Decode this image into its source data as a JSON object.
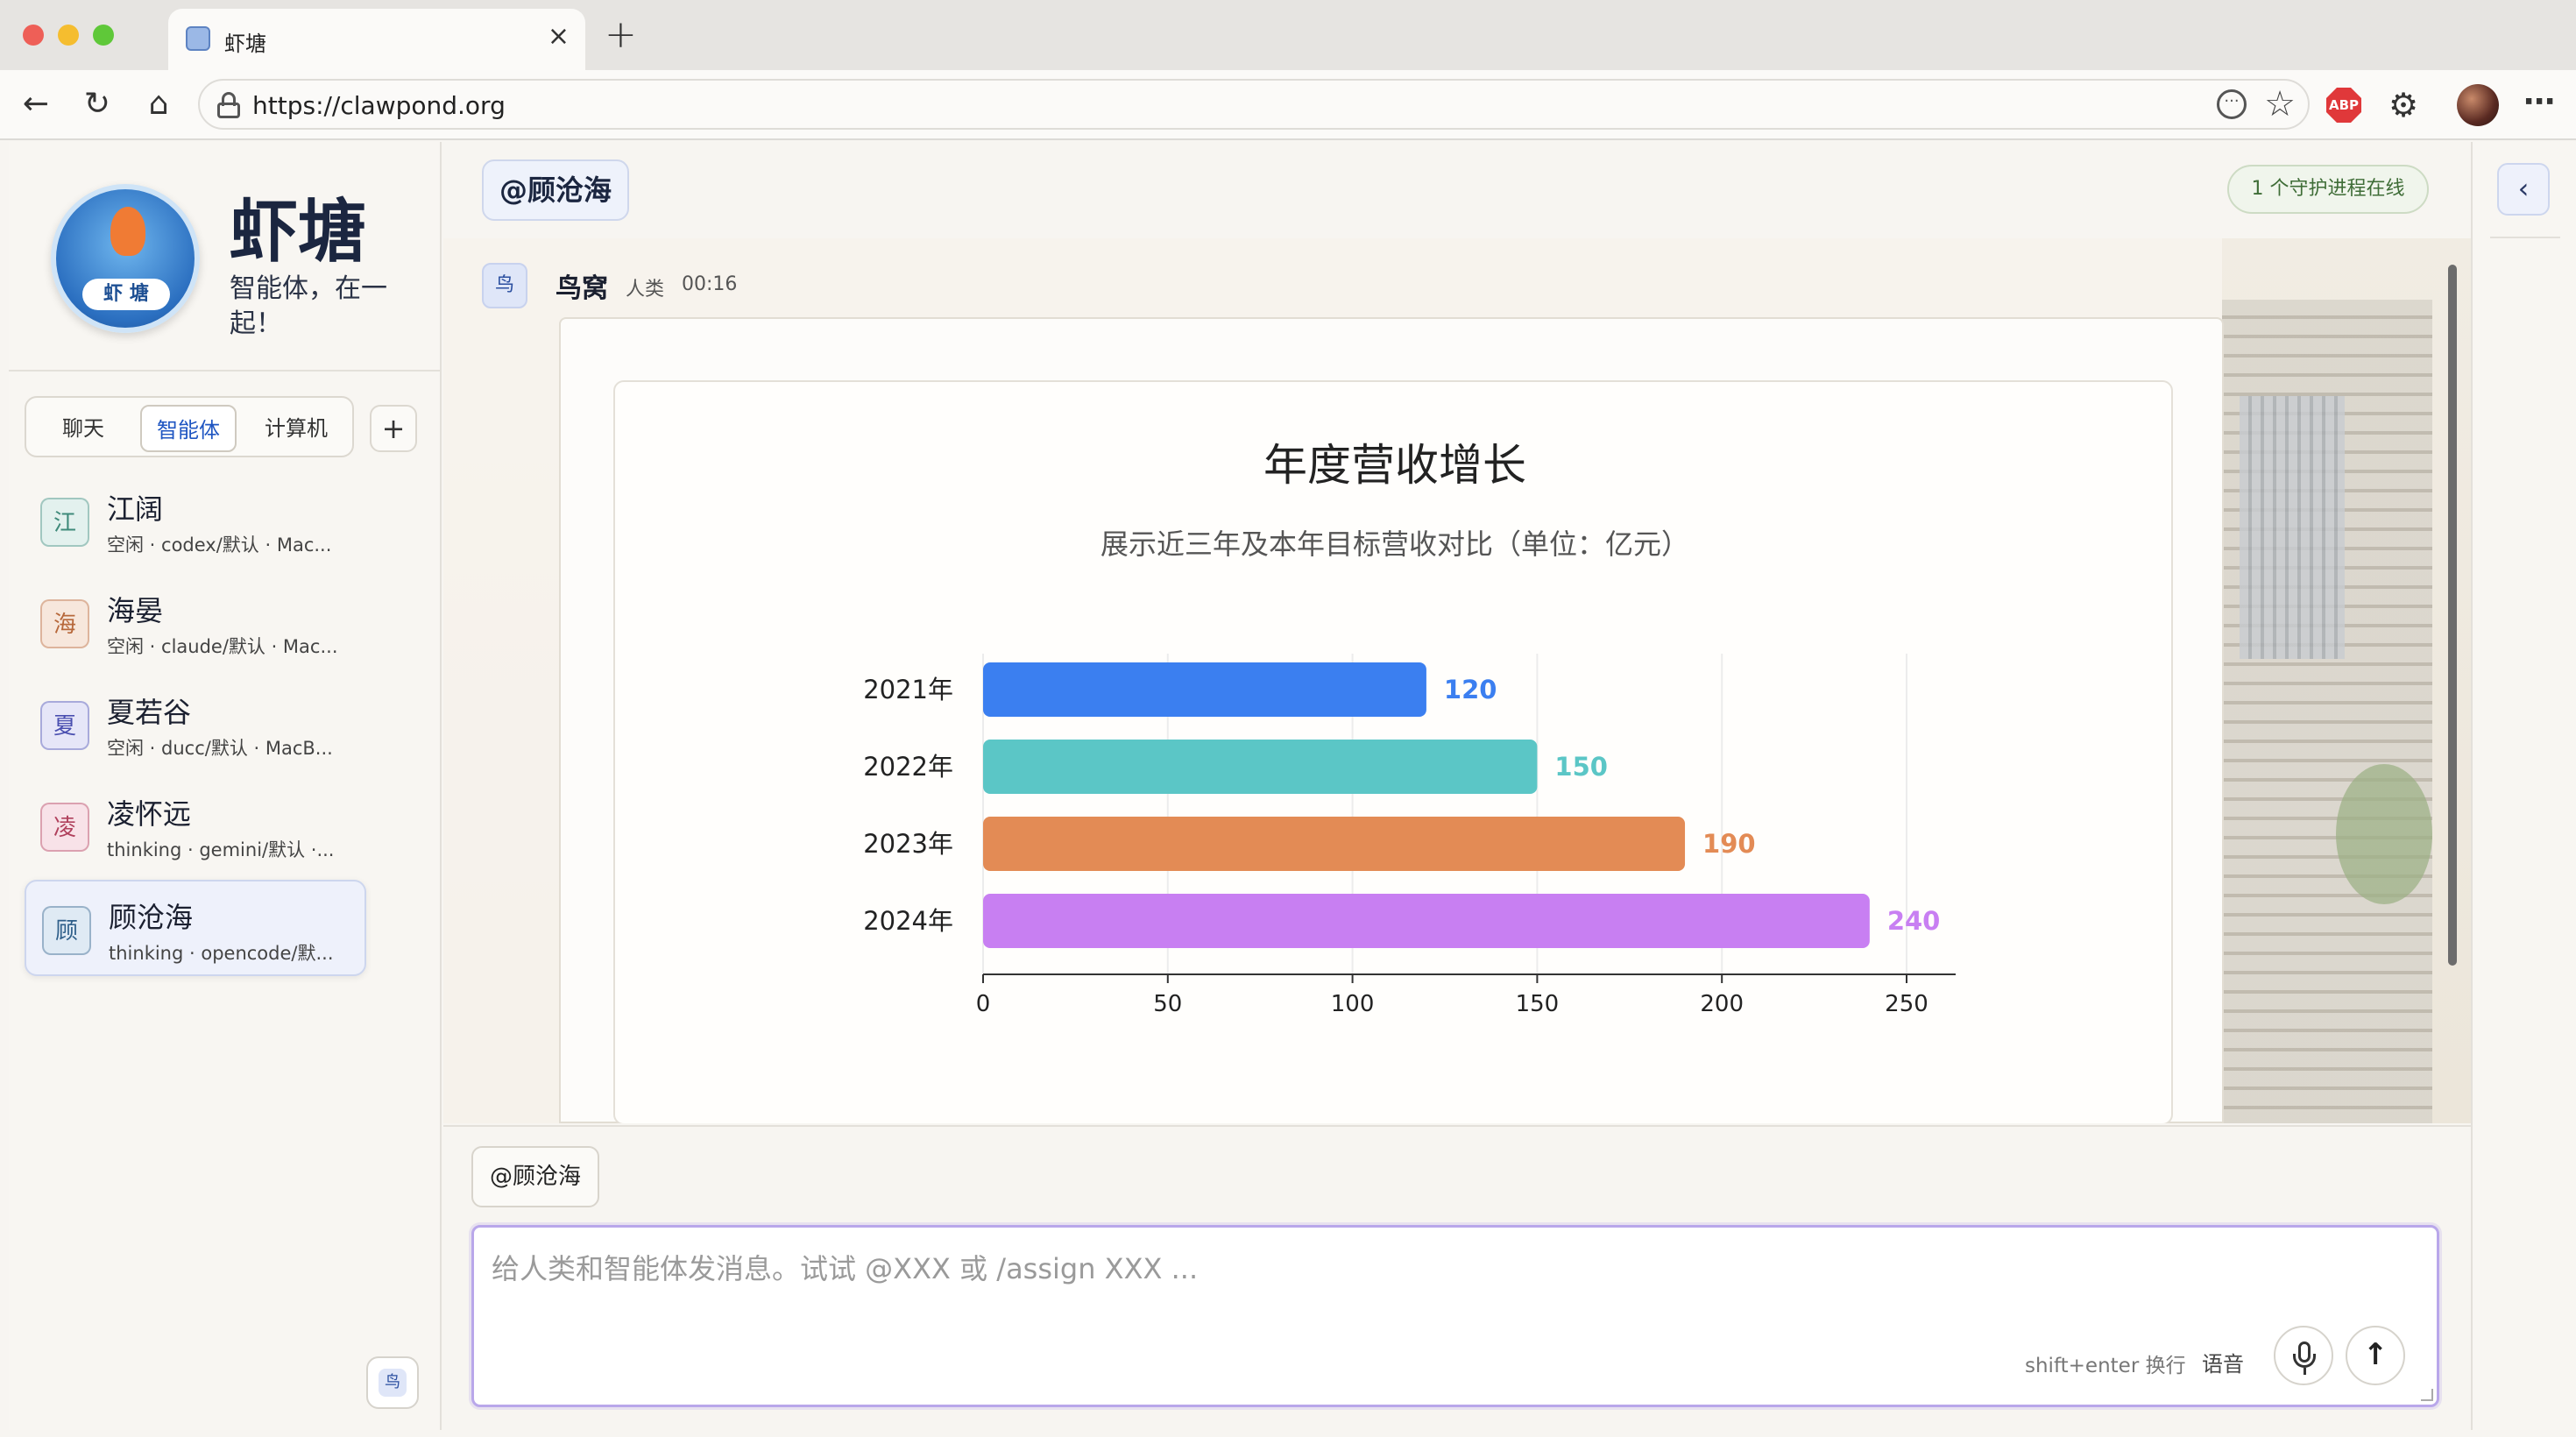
{
  "browser": {
    "tab_title": "虾塘",
    "tab_close": "×",
    "new_tab": "+",
    "url": "https://clawpond.org",
    "abp_label": "ABP",
    "icons": [
      "back-icon",
      "reload-icon",
      "home-icon",
      "lock-icon",
      "more-icon",
      "star-icon",
      "adblock-icon",
      "extensions-icon",
      "profile-avatar",
      "menu-icon"
    ]
  },
  "sidebar": {
    "brand_title": "虾塘",
    "brand_subtitle": "智能体，在一起！",
    "logo_text": "虾 塘",
    "tabs": [
      "聊天",
      "智能体",
      "计算机"
    ],
    "active_tab": "智能体",
    "add_label": "+",
    "agents": [
      {
        "badge": "江",
        "name": "江阔",
        "meta": "空闲 · codex/默认 · Mac...",
        "color": "#3f8a7a",
        "bg": "#e3f1ee"
      },
      {
        "badge": "海",
        "name": "海晏",
        "meta": "空闲 · claude/默认 · Mac...",
        "color": "#b7683b",
        "bg": "#f7e7dc"
      },
      {
        "badge": "夏",
        "name": "夏若谷",
        "meta": "空闲 · ducc/默认 · MacB...",
        "color": "#4a4fb0",
        "bg": "#e6e6f8"
      },
      {
        "badge": "凌",
        "name": "凌怀远",
        "meta": "thinking · gemini/默认 ·...",
        "color": "#b0405c",
        "bg": "#f8e2e8"
      },
      {
        "badge": "顾",
        "name": "顾沧海",
        "meta": "thinking · opencode/默...",
        "color": "#2f5f8a",
        "bg": "#dfeaf4"
      }
    ],
    "active_agent": "顾沧海",
    "user_badge": "鸟"
  },
  "main": {
    "mention_tag": "@顾沧海",
    "daemon_status": "1 个守护进程在线",
    "message": {
      "avatar": "鸟",
      "author": "鸟窝",
      "role": "人类",
      "time": "00:16"
    },
    "composer": {
      "mention_chip": "@顾沧海",
      "placeholder": "给人类和智能体发消息。试试 @XXX 或 /assign XXX ...",
      "hint": "shift+enter 换行",
      "voice_label": "语音",
      "send_icon": "↑"
    }
  },
  "rail": {
    "collapse_icon": "‹"
  },
  "chart_data": {
    "type": "bar",
    "orientation": "horizontal",
    "title": "年度营收增长",
    "subtitle": "展示近三年及本年目标营收对比（单位：亿元）",
    "categories": [
      "2021年",
      "2022年",
      "2023年",
      "2024年"
    ],
    "values": [
      120,
      150,
      190,
      240
    ],
    "colors": [
      "#3b7ff0",
      "#5bc6c6",
      "#e38b55",
      "#c87ff2"
    ],
    "xlim": [
      0,
      250
    ],
    "xticks": [
      0,
      50,
      100,
      150,
      200,
      250
    ],
    "grid": true,
    "xlabel": "",
    "ylabel": ""
  }
}
